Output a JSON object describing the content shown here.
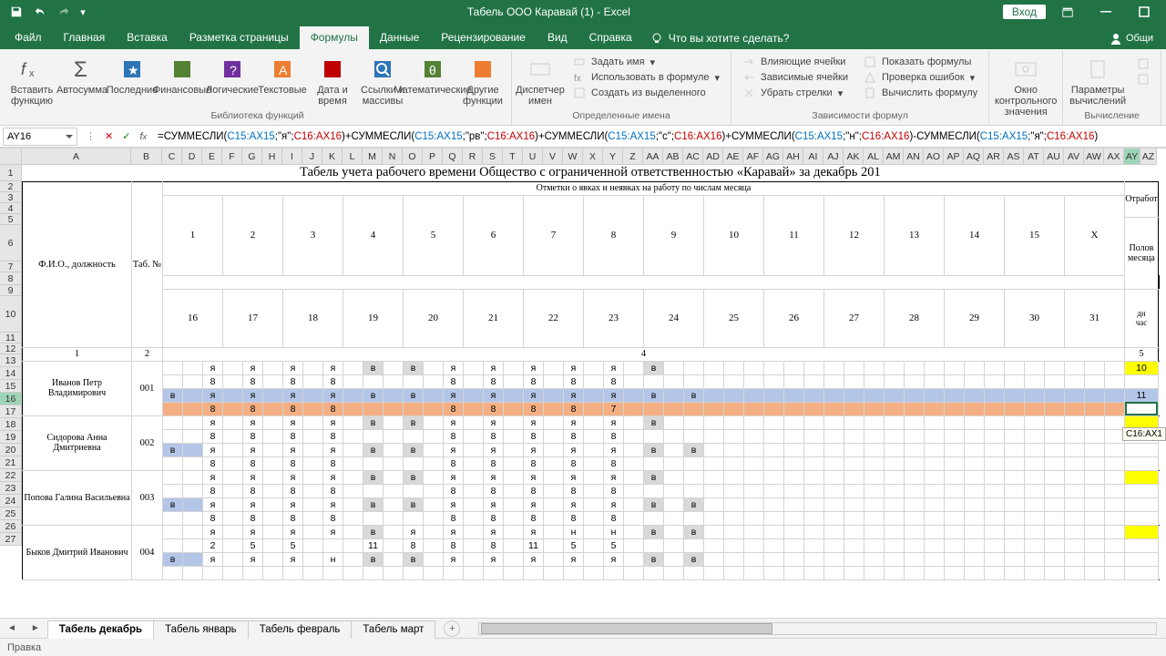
{
  "title": "Табель ООО Каравай (1) - Excel",
  "signin": "Вход",
  "share_label": "Общи",
  "tabs": {
    "file": "Файл",
    "home": "Главная",
    "insert": "Вставка",
    "layout": "Разметка страницы",
    "formulas": "Формулы",
    "data": "Данные",
    "review": "Рецензирование",
    "view": "Вид",
    "help": "Справка",
    "tellme": "Что вы хотите сделать?"
  },
  "ribbon": {
    "insert_fn": "Вставить функцию",
    "autosum": "Автосумма",
    "recent": "Последние",
    "financial": "Финансовые",
    "logical": "Логические",
    "text": "Текстовые",
    "datetime": "Дата и время",
    "lookup": "Ссылки и массивы",
    "math": "Математические",
    "more": "Другие функции",
    "lib_label": "Библиотека функций",
    "namemgr": "Диспетчер имен",
    "define": "Задать имя",
    "use_in": "Использовать в формуле",
    "create_from": "Создать из выделенного",
    "names_label": "Определенные имена",
    "trace_prec": "Влияющие ячейки",
    "trace_dep": "Зависимые ячейки",
    "remove_arrow": "Убрать стрелки",
    "show_f": "Показать формулы",
    "error_chk": "Проверка ошибок",
    "eval": "Вычислить формулу",
    "audit_label": "Зависимости формул",
    "watch": "Окно контрольного значения",
    "calc_opts": "Параметры вычислений",
    "calc_label": "Вычисление"
  },
  "namebox": "AY16",
  "formula_prefix": "=",
  "formula": "СУММЕСЛИ(C15:AX15;\"я\";C16:AX16)+СУММЕСЛИ(C15:AX15;\"рв\";C16:AX16)+СУММЕСЛИ(C15:AX15;\"с\";C16:AX16)+СУММЕСЛИ(C15:AX15;\"н\";C16:AX16)-СУММЕСЛИ(C15:AX15;\"я\";C16:AX16)",
  "columns": [
    "A",
    "B",
    "C",
    "D",
    "E",
    "F",
    "G",
    "H",
    "I",
    "J",
    "K",
    "L",
    "M",
    "N",
    "O",
    "P",
    "Q",
    "R",
    "S",
    "T",
    "U",
    "V",
    "W",
    "X",
    "Y",
    "Z",
    "AA",
    "AB",
    "AC",
    "AD",
    "AE",
    "AF",
    "AG",
    "AH",
    "AI",
    "AJ",
    "AK",
    "AL",
    "AM",
    "AN",
    "AO",
    "AP",
    "AQ",
    "AR",
    "AS",
    "AT",
    "AU",
    "AV",
    "AW",
    "AX",
    "AY",
    "AZ"
  ],
  "row_nums": [
    1,
    2,
    3,
    4,
    5,
    6,
    7,
    8,
    9,
    10,
    11,
    12,
    13,
    14,
    15,
    16,
    17,
    18,
    19,
    20,
    21,
    22,
    23,
    24,
    25,
    26,
    27
  ],
  "doc_title": "Табель учета рабочего времени Общество с ограниченной ответственностью «Каравай» за декабрь 201",
  "subhead": "Отметки о явках и неявках на работу по числам месяца",
  "fio": "Ф.И.О., должность",
  "tabno": "Таб. №",
  "rightcol": "Отработ",
  "polov": "Полов месяца",
  "dn": "дн",
  "chas": "час",
  "days_top": [
    "1",
    "2",
    "3",
    "4",
    "5",
    "6",
    "7",
    "8",
    "9",
    "10",
    "11",
    "12",
    "13",
    "14",
    "15",
    "X"
  ],
  "days_bot": [
    "16",
    "17",
    "18",
    "19",
    "20",
    "21",
    "22",
    "23",
    "24",
    "25",
    "26",
    "27",
    "28",
    "29",
    "30",
    "31"
  ],
  "rownum2": [
    "1",
    "2",
    "",
    "4",
    "5"
  ],
  "emp": [
    {
      "name": "Иванов Петр Владимирович",
      "num": "001",
      "r1": [
        "",
        "",
        "я",
        "",
        "я",
        "",
        "я",
        "",
        "я",
        "",
        "в",
        "",
        "в",
        "",
        "я",
        "",
        "я",
        "",
        "я",
        "",
        "я",
        "",
        "я",
        "",
        "в"
      ],
      "r2": [
        "",
        "",
        "8",
        "",
        "8",
        "",
        "8",
        "",
        "8",
        "",
        "",
        "",
        "",
        "",
        "8",
        "",
        "8",
        "",
        "8",
        "",
        "8",
        "",
        "8",
        "",
        ""
      ],
      "v1": "10",
      "r3": [
        "в",
        "",
        "я",
        "",
        "я",
        "",
        "я",
        "",
        "я",
        "",
        "в",
        "",
        "в",
        "",
        "я",
        "",
        "я",
        "",
        "я",
        "",
        "я",
        "",
        "я",
        "",
        "в",
        "",
        "в"
      ],
      "r4": [
        "",
        "",
        "8",
        "",
        "8",
        "",
        "8",
        "",
        "8",
        "",
        "",
        "",
        "",
        "",
        "8",
        "",
        "8",
        "",
        "8",
        "",
        "8",
        "",
        "7",
        "",
        ""
      ],
      "v2": "11",
      "y1": true,
      "y2": false,
      "sel_rows": [
        3,
        4
      ]
    },
    {
      "name": "Сидорова Анна Дмитриевна",
      "num": "002",
      "r1": [
        "",
        "",
        "я",
        "",
        "я",
        "",
        "я",
        "",
        "я",
        "",
        "в",
        "",
        "в",
        "",
        "я",
        "",
        "я",
        "",
        "я",
        "",
        "я",
        "",
        "я",
        "",
        "в"
      ],
      "r2": [
        "",
        "",
        "8",
        "",
        "8",
        "",
        "8",
        "",
        "8",
        "",
        "",
        "",
        "",
        "",
        "8",
        "",
        "8",
        "",
        "8",
        "",
        "8",
        "",
        "8",
        "",
        ""
      ],
      "v1": "",
      "r3": [
        "в",
        "",
        "я",
        "",
        "я",
        "",
        "я",
        "",
        "я",
        "",
        "в",
        "",
        "в",
        "",
        "я",
        "",
        "я",
        "",
        "я",
        "",
        "я",
        "",
        "я",
        "",
        "в",
        "",
        "в"
      ],
      "r4": [
        "",
        "",
        "8",
        "",
        "8",
        "",
        "8",
        "",
        "8",
        "",
        "",
        "",
        "",
        "",
        "8",
        "",
        "8",
        "",
        "8",
        "",
        "8",
        "",
        "8",
        "",
        ""
      ],
      "v2": "",
      "y1": true,
      "y2": false
    },
    {
      "name": "Попова Галина Васильевна",
      "num": "003",
      "r1": [
        "",
        "",
        "я",
        "",
        "я",
        "",
        "я",
        "",
        "я",
        "",
        "в",
        "",
        "в",
        "",
        "я",
        "",
        "я",
        "",
        "я",
        "",
        "я",
        "",
        "я",
        "",
        "в"
      ],
      "r2": [
        "",
        "",
        "8",
        "",
        "8",
        "",
        "8",
        "",
        "8",
        "",
        "",
        "",
        "",
        "",
        "8",
        "",
        "8",
        "",
        "8",
        "",
        "8",
        "",
        "8",
        "",
        ""
      ],
      "y1": true,
      "r3": [
        "в",
        "",
        "я",
        "",
        "я",
        "",
        "я",
        "",
        "я",
        "",
        "в",
        "",
        "в",
        "",
        "я",
        "",
        "я",
        "",
        "я",
        "",
        "я",
        "",
        "я",
        "",
        "в",
        "",
        "в"
      ],
      "r4": [
        "",
        "",
        "8",
        "",
        "8",
        "",
        "8",
        "",
        "8",
        "",
        "",
        "",
        "",
        "",
        "8",
        "",
        "8",
        "",
        "8",
        "",
        "8",
        "",
        "8",
        "",
        ""
      ],
      "y2": false
    },
    {
      "name": "Быков Дмитрий Иванович",
      "num": "004",
      "r1": [
        "",
        "",
        "я",
        "",
        "я",
        "",
        "я",
        "",
        "я",
        "",
        "в",
        "",
        "я",
        "",
        "я",
        "",
        "я",
        "",
        "я",
        "",
        "н",
        "",
        "н",
        "",
        "в",
        "",
        "в"
      ],
      "r2": [
        "",
        "",
        "2",
        "",
        "5",
        "",
        "5",
        "",
        "",
        "",
        "11",
        "",
        "8",
        "",
        "8",
        "",
        "8",
        "",
        "11",
        "",
        "5",
        "",
        "5",
        "",
        ""
      ],
      "y1": true,
      "r3": [
        "в",
        "",
        "я",
        "",
        "я",
        "",
        "я",
        "",
        "н",
        "",
        "в",
        "",
        "в",
        "",
        "я",
        "",
        "я",
        "",
        "я",
        "",
        "я",
        "",
        "я",
        "",
        "в",
        "",
        "в"
      ],
      "r4": [],
      "y2": false
    }
  ],
  "tooltip": "C16:AX1",
  "sheets": [
    "Табель декабрь",
    "Табель январь",
    "Табель февраль",
    "Табель март"
  ],
  "status": "Правка"
}
